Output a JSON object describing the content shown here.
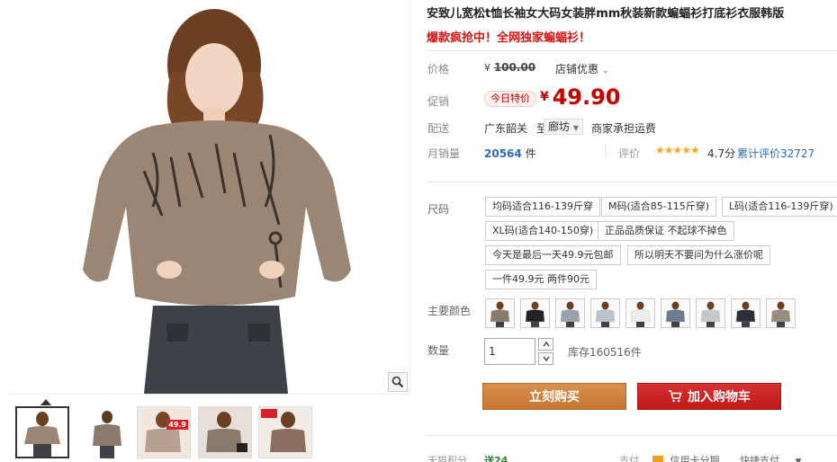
{
  "product": {
    "title": "安致儿宽松t恤长袖女大码女装胖mm秋装新款蝙蝠衫打底衫衣服韩版",
    "subtitle": "爆款疯抢中！全网独家蝙蝠衫！"
  },
  "price": {
    "label": "价格",
    "currency": "¥",
    "original": "100.00",
    "shop_promo": "店铺优惠"
  },
  "promo": {
    "label": "促销",
    "tag": "今日特价",
    "currency": "¥",
    "current": "49.90"
  },
  "shipping": {
    "label": "配送",
    "from": "广东韶关",
    "to_word": "至",
    "to": "廊坊",
    "note": "商家承担运费"
  },
  "sales": {
    "label": "月销量",
    "count": "20564",
    "unit": "件",
    "review_label": "评价",
    "stars": "★★★★★",
    "rating": "4.7分",
    "total_reviews": "累计评价32727"
  },
  "size": {
    "label": "尺码",
    "options": [
      "均码适合116-139斤穿",
      "M码(适合85-115斤穿)",
      "L码(适合116-139斤穿)",
      "XL码(适合140-150穿)",
      "正品品质保证 不起球不掉色",
      "今天是最后一天49.9元包邮",
      "所以明天不要问为什么涨价呢",
      "一件49.9元 两件90元"
    ]
  },
  "color": {
    "label": "主要颜色",
    "swatch_tones": [
      "#8a7a6c",
      "#222222",
      "#9aa3ad",
      "#b9c4cf",
      "#eeeeee",
      "#6b7d8f",
      "#c6c9cc",
      "#2a2f38",
      "#9a8b7c"
    ]
  },
  "quantity": {
    "label": "数量",
    "value": "1",
    "stock": "库存160516件"
  },
  "actions": {
    "buy_now": "立刻购买",
    "add_cart": "加入购物车"
  },
  "footer": {
    "points_label": "天猫积分",
    "points_value": "送24",
    "pay_label": "支付",
    "credit": "信用卡分期",
    "fast_pay": "快捷支付"
  },
  "thumbs": {
    "badge": "49.9"
  },
  "colors": {
    "accent_red": "#c40000",
    "buy_orange": "#c6762f",
    "link_blue": "#2b6cb8"
  }
}
